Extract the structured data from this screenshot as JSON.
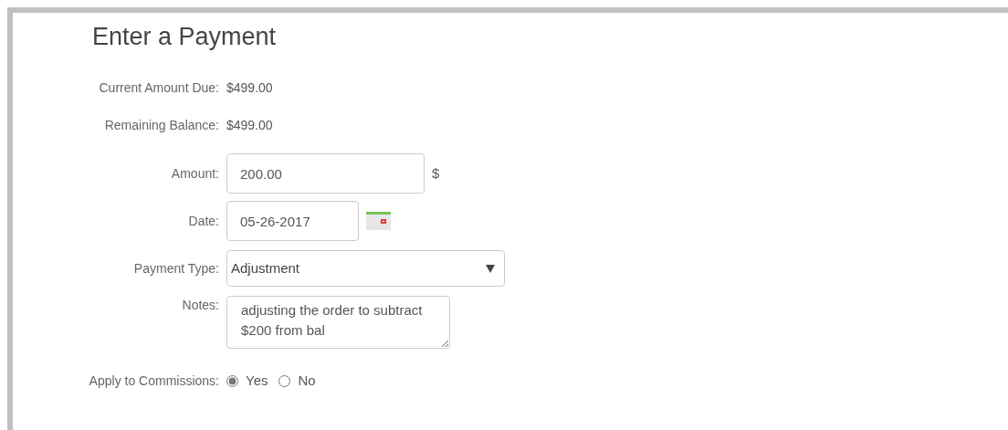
{
  "title": "Enter a Payment",
  "summary": [
    {
      "label": "Current Amount Due:",
      "value": "$499.00"
    },
    {
      "label": "Remaining Balance:",
      "value": "$499.00"
    }
  ],
  "fields": [
    {
      "kind": "text",
      "label": "Amount:",
      "value": "200.00",
      "suffix": "$"
    },
    {
      "kind": "date",
      "label": "Date:",
      "value": "05-26-2017"
    },
    {
      "kind": "select",
      "label": "Payment Type:",
      "value": "Adjustment"
    },
    {
      "kind": "textarea",
      "label": "Notes:",
      "value": "adjusting the order to subtract $200 from bal"
    },
    {
      "kind": "radio",
      "label": "Apply to Commissions:",
      "options": [
        {
          "label": "Yes",
          "selected": true
        },
        {
          "label": "No",
          "selected": false
        }
      ]
    }
  ]
}
